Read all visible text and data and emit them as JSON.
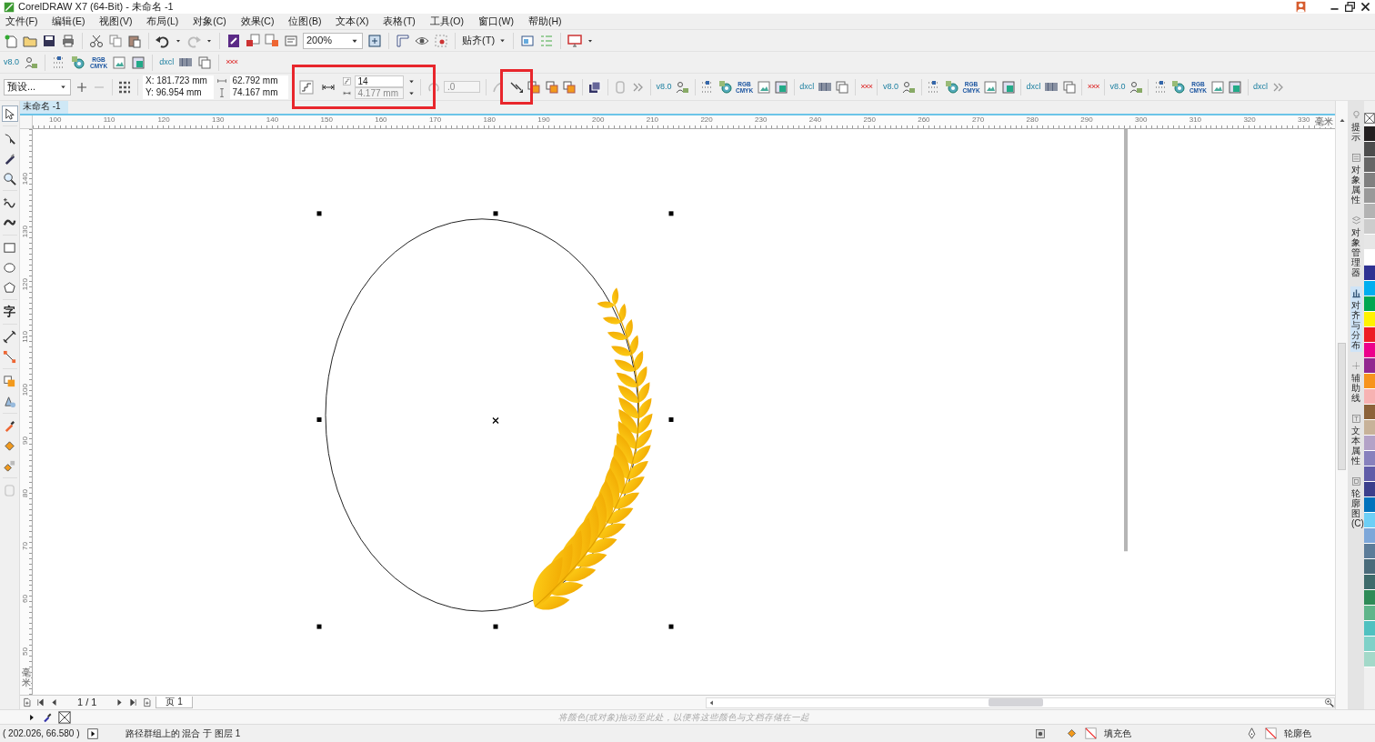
{
  "window": {
    "title": "CorelDRAW X7 (64-Bit) - 未命名 -1"
  },
  "menu": [
    "文件(F)",
    "编辑(E)",
    "视图(V)",
    "布局(L)",
    "对象(C)",
    "效果(C)",
    "位图(B)",
    "文本(X)",
    "表格(T)",
    "工具(O)",
    "窗口(W)",
    "帮助(H)"
  ],
  "standard_toolbar": [
    {
      "kind": "new"
    },
    {
      "kind": "open"
    },
    {
      "kind": "save"
    },
    {
      "kind": "print"
    },
    {
      "kind": "separator"
    },
    {
      "kind": "cut"
    },
    {
      "kind": "copy"
    },
    {
      "kind": "paste"
    },
    {
      "kind": "separator"
    },
    {
      "kind": "undo"
    },
    {
      "kind": "redo"
    },
    {
      "kind": "separator"
    },
    {
      "kind": "app"
    },
    {
      "kind": "import"
    },
    {
      "kind": "export"
    },
    {
      "kind": "pdf"
    },
    {
      "kind": "zoom",
      "value": "200%"
    },
    {
      "kind": "fullscreen"
    },
    {
      "kind": "separator"
    },
    {
      "kind": "rulers"
    },
    {
      "kind": "eye"
    },
    {
      "kind": "snapgrid"
    },
    {
      "kind": "separator"
    },
    {
      "kind": "snap",
      "label": "贴齐(T)"
    },
    {
      "kind": "separator"
    },
    {
      "kind": "options"
    },
    {
      "kind": "list"
    },
    {
      "kind": "separator"
    },
    {
      "kind": "monitor"
    }
  ],
  "macro_toolbar": [
    {
      "kind": "label",
      "text": "v8.0"
    },
    {
      "kind": "person"
    },
    {
      "kind": "separator"
    },
    {
      "kind": "dots"
    },
    {
      "kind": "gear"
    },
    {
      "kind": "rgb",
      "text": "RGB",
      "text_2": "CMYK"
    },
    {
      "kind": "picture"
    },
    {
      "kind": "frame"
    },
    {
      "kind": "separator"
    },
    {
      "kind": "label",
      "text": "dxcl"
    },
    {
      "kind": "barcode"
    },
    {
      "kind": "pages"
    },
    {
      "kind": "separator"
    },
    {
      "kind": "cross",
      "text": "×××"
    }
  ],
  "property_bar": {
    "preset": "预设...",
    "x": "X: 181.723 mm",
    "y": "Y: 96.954 mm",
    "width": "62.792 mm",
    "height": "74.167 mm",
    "steps": {
      "value": "14",
      "disabled": false
    },
    "spacing": {
      "value": "4.177 mm",
      "disabled": true
    },
    "rotation": {
      "value": ".0",
      "disabled": true
    },
    "macros": [
      {
        "kind": "label",
        "text": "v8.0"
      },
      {
        "kind": "person"
      },
      {
        "kind": "separator"
      },
      {
        "kind": "dots"
      },
      {
        "kind": "gear"
      },
      {
        "kind": "rgb",
        "text": "RGB",
        "text_2": "CMYK"
      },
      {
        "kind": "picture"
      },
      {
        "kind": "frame"
      },
      {
        "kind": "separator"
      },
      {
        "kind": "label",
        "text": "dxcl"
      },
      {
        "kind": "barcode"
      },
      {
        "kind": "pages"
      },
      {
        "kind": "separator"
      },
      {
        "kind": "cross",
        "text": "×××"
      },
      {
        "kind": "separator"
      },
      {
        "kind": "label",
        "text": "v8.0"
      },
      {
        "kind": "person"
      },
      {
        "kind": "separator"
      },
      {
        "kind": "dots"
      },
      {
        "kind": "gear"
      },
      {
        "kind": "rgb",
        "text": "RGB",
        "text_2": "CMYK"
      },
      {
        "kind": "picture"
      },
      {
        "kind": "frame"
      },
      {
        "kind": "separator"
      },
      {
        "kind": "label",
        "text": "dxcl"
      },
      {
        "kind": "barcode"
      },
      {
        "kind": "pages"
      },
      {
        "kind": "separator"
      },
      {
        "kind": "cross",
        "text": "×××"
      },
      {
        "kind": "separator"
      },
      {
        "kind": "label",
        "text": "v8.0"
      },
      {
        "kind": "person"
      },
      {
        "kind": "separator"
      },
      {
        "kind": "dots"
      },
      {
        "kind": "gear"
      },
      {
        "kind": "rgb",
        "text": "RGB",
        "text_2": "CMYK"
      },
      {
        "kind": "picture"
      },
      {
        "kind": "frame"
      },
      {
        "kind": "separator"
      },
      {
        "kind": "label",
        "text": "dxcl"
      }
    ]
  },
  "toolbox": [
    {
      "kind": "pointer",
      "selected": true
    },
    {
      "kind": "shape",
      "selected": false
    },
    {
      "kind": "knife",
      "selected": false
    },
    {
      "kind": "zoom",
      "selected": false
    },
    {
      "kind": "freehand",
      "selected": false
    },
    {
      "kind": "brush",
      "selected": false
    },
    {
      "kind": "rect",
      "selected": false
    },
    {
      "kind": "ellipse",
      "selected": false
    },
    {
      "kind": "polygon",
      "selected": false
    },
    {
      "kind": "text",
      "label": "字",
      "selected": false
    },
    {
      "kind": "dimension",
      "selected": false
    },
    {
      "kind": "connector",
      "selected": false
    },
    {
      "kind": "shadow",
      "selected": false
    },
    {
      "kind": "transparency",
      "selected": false
    },
    {
      "kind": "eyedropper",
      "selected": false
    },
    {
      "kind": "fill",
      "selected": false
    },
    {
      "kind": "smartfill",
      "selected": false
    },
    {
      "kind": "addtool",
      "selected": false
    }
  ],
  "document_tab": {
    "label": "未命名 -1"
  },
  "ruler_top": {
    "labels": [
      "100",
      "110",
      "120",
      "130",
      "140",
      "150",
      "160",
      "170",
      "180",
      "190",
      "200",
      "210",
      "220",
      "230",
      "240",
      "250",
      "260",
      "270",
      "280",
      "290",
      "300",
      "310",
      "320",
      "330"
    ],
    "unit": "毫米"
  },
  "ruler_left": {
    "labels": [
      "140",
      "130",
      "120",
      "110",
      "100",
      "90",
      "80",
      "70",
      "60",
      "50"
    ],
    "unit": "毫米"
  },
  "page_nav": {
    "counter": "1 / 1",
    "pages": [
      {
        "label": "页 1",
        "selected": true
      }
    ]
  },
  "palette_hint": "将颜色(或对象)拖动至此处，以便将这些颜色与文档存储在一起",
  "dockers": [
    {
      "label": "提示",
      "selected": false
    },
    {
      "label": "对象属性",
      "selected": false
    },
    {
      "label": "对象管理器",
      "selected": false
    },
    {
      "label": "对齐与分布",
      "selected": true
    },
    {
      "label": "辅助线",
      "selected": false
    },
    {
      "label": "文本属性",
      "selected": false
    },
    {
      "label": "轮廓图(C)",
      "selected": false
    }
  ],
  "palette": [
    {
      "kind": "none"
    },
    {
      "kind": "swatch",
      "color": "#231f20"
    },
    {
      "kind": "swatch",
      "color": "#4d4d4d"
    },
    {
      "kind": "swatch",
      "color": "#666666"
    },
    {
      "kind": "swatch",
      "color": "#808080"
    },
    {
      "kind": "swatch",
      "color": "#999999"
    },
    {
      "kind": "swatch",
      "color": "#b3b3b3"
    },
    {
      "kind": "swatch",
      "color": "#cccccc"
    },
    {
      "kind": "swatch",
      "color": "#e6e6e6"
    },
    {
      "kind": "swatch",
      "color": "#ffffff"
    },
    {
      "kind": "swatch",
      "color": "#2e3192"
    },
    {
      "kind": "swatch",
      "color": "#00aeef"
    },
    {
      "kind": "swatch",
      "color": "#00a651"
    },
    {
      "kind": "swatch",
      "color": "#fff200"
    },
    {
      "kind": "swatch",
      "color": "#ed1c24"
    },
    {
      "kind": "swatch",
      "color": "#ec008c"
    },
    {
      "kind": "swatch",
      "color": "#92278f"
    },
    {
      "kind": "swatch",
      "color": "#f7941d"
    },
    {
      "kind": "swatch",
      "color": "#f7b2b2"
    },
    {
      "kind": "swatch",
      "color": "#8c6239"
    },
    {
      "kind": "swatch",
      "color": "#c7b299"
    },
    {
      "kind": "swatch",
      "color": "#b3a2c7"
    },
    {
      "kind": "swatch",
      "color": "#8781bd"
    },
    {
      "kind": "swatch",
      "color": "#605ca8"
    },
    {
      "kind": "swatch",
      "color": "#3b3f8c"
    },
    {
      "kind": "swatch",
      "color": "#0072bc"
    },
    {
      "kind": "swatch",
      "color": "#6dcff6"
    },
    {
      "kind": "swatch",
      "color": "#7da7d9"
    },
    {
      "kind": "swatch",
      "color": "#5c7c99"
    },
    {
      "kind": "swatch",
      "color": "#4a6b7a"
    },
    {
      "kind": "swatch",
      "color": "#3e6b6b"
    },
    {
      "kind": "swatch",
      "color": "#2e8b57"
    },
    {
      "kind": "swatch",
      "color": "#5fb58a"
    },
    {
      "kind": "swatch",
      "color": "#4fc1c0"
    },
    {
      "kind": "swatch",
      "color": "#7fd1c8"
    },
    {
      "kind": "swatch",
      "color": "#a3d9c9"
    }
  ],
  "status_bar": {
    "coordinates": "( 202.026, 66.580 )",
    "info": "路径群组上的 混合 于 图层 1",
    "fill": "填充色",
    "outline": "轮廓色"
  }
}
